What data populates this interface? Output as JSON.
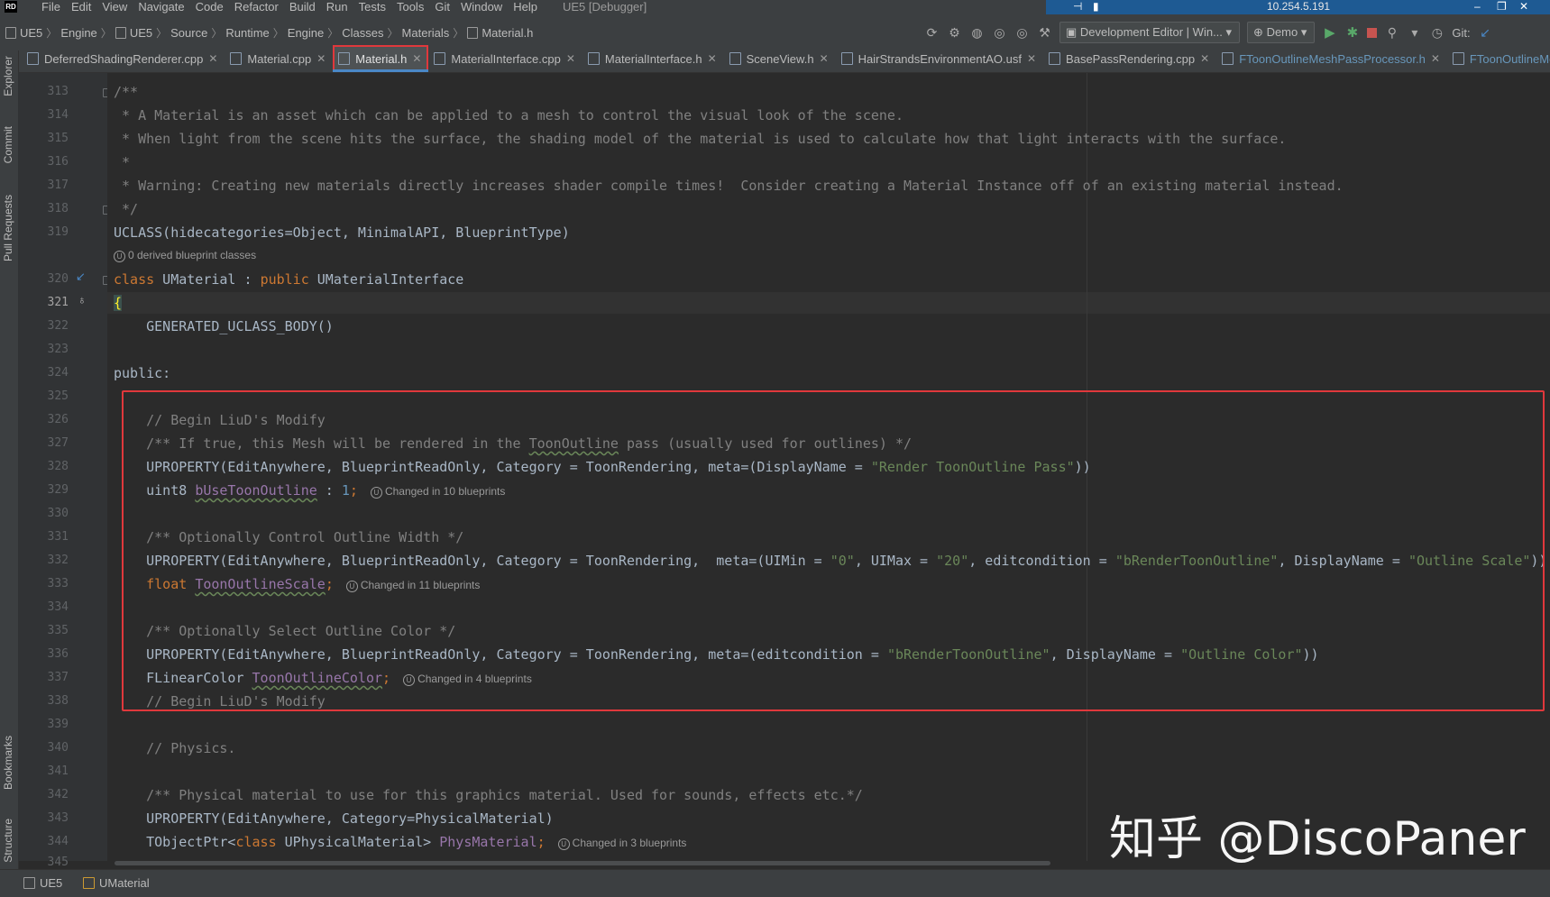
{
  "menubar": {
    "logo": "RD",
    "items": [
      "File",
      "Edit",
      "View",
      "Navigate",
      "Code",
      "Refactor",
      "Build",
      "Run",
      "Tests",
      "Tools",
      "Git",
      "Window",
      "Help"
    ],
    "window_title": "UE5 [Debugger]"
  },
  "remote": {
    "ip": "10.254.5.191"
  },
  "breadcrumbs": [
    "UE5",
    "Engine",
    "UE5",
    "Source",
    "Runtime",
    "Engine",
    "Classes",
    "Materials",
    "Material.h"
  ],
  "toolbar": {
    "config": "Development Editor | Win...",
    "project": "Demo",
    "git_label": "Git:"
  },
  "tabs": [
    {
      "label": "DeferredShadingRenderer.cpp"
    },
    {
      "label": "Material.cpp"
    },
    {
      "label": "Material.h"
    },
    {
      "label": "MaterialInterface.cpp"
    },
    {
      "label": "MaterialInterface.h"
    },
    {
      "label": "SceneView.h"
    },
    {
      "label": "HairStrandsEnvironmentAO.usf"
    },
    {
      "label": "BasePassRendering.cpp"
    },
    {
      "label": "FToonOutlineMeshPassProcessor.h"
    },
    {
      "label": "FToonOutlineMe"
    }
  ],
  "left_tools": [
    "Explorer",
    "Commit",
    "Pull Requests",
    "Bookmarks",
    "Structure"
  ],
  "editor": {
    "line_numbers": [
      "313",
      "314",
      "315",
      "316",
      "317",
      "318",
      "319",
      "320",
      "321",
      "322",
      "323",
      "324",
      "325",
      "326",
      "327",
      "328",
      "329",
      "330",
      "331",
      "332",
      "333",
      "334",
      "335",
      "336",
      "337",
      "338",
      "339",
      "340",
      "341",
      "342",
      "343",
      "344",
      "345"
    ],
    "current_line": "321",
    "code": {
      "l313": "/**",
      "l314": " * A Material is an asset which can be applied to a mesh to control the visual look of the scene.",
      "l315": " * When light from the scene hits the surface, the shading model of the material is used to calculate how that light interacts with the surface.",
      "l316": " *",
      "l317": " * Warning: Creating new materials directly increases shader compile times!  Consider creating a Material Instance off of an existing material instead.",
      "l318": " */",
      "l319": "UCLASS(hidecategories=Object, MinimalAPI, BlueprintType)",
      "l320_kw1": "class",
      "l320_name": " UMaterial : ",
      "l320_kw2": "public",
      "l320_base": " UMaterialInterface",
      "l321": "{",
      "l322": "    GENERATED_UCLASS_BODY()",
      "l324": "public:",
      "l326": "    // Begin LiuD's Modify",
      "l327_a": "    /** If true, this Mesh will be rendered in the ",
      "l327_b": "ToonOutline",
      "l327_c": " pass (usually used for outlines) */",
      "l328_a": "    UPROPERTY(EditAnywhere, BlueprintReadOnly, Category = ToonRendering, meta=(DisplayName = ",
      "l328_s": "\"Render ToonOutline Pass\"",
      "l328_b": "))",
      "l329_a": "    uint8 ",
      "l329_f": "bUseToonOutline",
      "l329_b": " : ",
      "l329_n": "1",
      "l329_c": ";",
      "l331": "    /** Optionally Control Outline Width */",
      "l332_a": "    UPROPERTY(EditAnywhere, BlueprintReadOnly, Category = ToonRendering,  meta=(UIMin = ",
      "l332_s1": "\"0\"",
      "l332_b": ", UIMax = ",
      "l332_s2": "\"20\"",
      "l332_c": ", editcondition = ",
      "l332_s3": "\"bRenderToonOutline\"",
      "l332_d": ", DisplayName = ",
      "l332_s4": "\"Outline Scale\"",
      "l332_e": "))",
      "l333_kw": "    float",
      "l333_f": "ToonOutlineScale",
      "l333_c": ";",
      "l335": "    /** Optionally Select Outline Color */",
      "l336_a": "    UPROPERTY(EditAnywhere, BlueprintReadOnly, Category = ToonRendering, meta=(editcondition = ",
      "l336_s1": "\"bRenderToonOutline\"",
      "l336_b": ", DisplayName = ",
      "l336_s2": "\"Outline Color\"",
      "l336_c": "))",
      "l337_a": "    FLinearColor ",
      "l337_f": "ToonOutlineColor",
      "l337_c": ";",
      "l338": "    // Begin LiuD's Modify",
      "l340": "    // Physics.",
      "l342": "    /** Physical material to use for this graphics material. Used for sounds, effects etc.*/",
      "l343": "    UPROPERTY(EditAnywhere, Category=PhysicalMaterial)",
      "l344_a": "    TObjectPtr<",
      "l344_kw": "class",
      "l344_b": " UPhysicalMaterial> ",
      "l344_f": "PhysMaterial",
      "l344_c": ";"
    },
    "hints": {
      "derived": "0 derived blueprint classes",
      "h329": "Changed in 10 blueprints",
      "h333": "Changed in 11 blueprints",
      "h337": "Changed in 4 blueprints",
      "h344": "Changed in 3 blueprints"
    }
  },
  "statusbar": {
    "project": "UE5",
    "symbol": "UMaterial"
  },
  "watermark": "知乎 @DiscoPaner",
  "colors": {
    "highlight_box": "#e0383c",
    "keyword": "#cc7832",
    "string": "#6a8759",
    "comment": "#808080",
    "field": "#9876aa"
  }
}
